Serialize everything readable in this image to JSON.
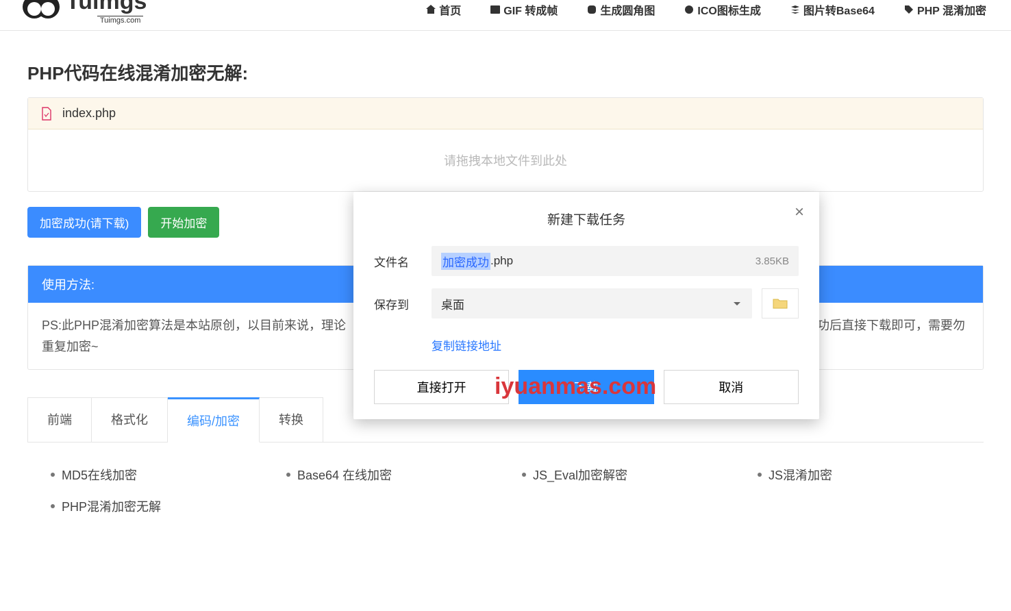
{
  "logo": {
    "text": "Tuimgs",
    "sub": "Tuimgs.com"
  },
  "nav": {
    "home": "首页",
    "gif": "GIF 转成帧",
    "circle": "生成圆角图",
    "ico": "ICO图标生成",
    "base64": "图片转Base64",
    "php": "PHP 混淆加密"
  },
  "page_title": "PHP代码在线混淆加密无解:",
  "upload": {
    "filename": "index.php",
    "drop_hint": "请拖拽本地文件到此处"
  },
  "buttons": {
    "download": "加密成功(请下载)",
    "start": "开始加密"
  },
  "usage": {
    "head": "使用方法:",
    "body_left": "PS:此PHP混淆加密算法是本站原创，以目前来说，理论",
    "body_right": "成功后直接下载即可，需要勿重复加密~"
  },
  "tabs": {
    "t1": "前端",
    "t2": "格式化",
    "t3": "编码/加密",
    "t4": "转换"
  },
  "tools": {
    "a": "MD5在线加密",
    "b": "Base64 在线加密",
    "c": "JS_Eval加密解密",
    "d": "JS混淆加密",
    "e": "PHP混淆加密无解"
  },
  "modal": {
    "title": "新建下载任务",
    "label_name": "文件名",
    "sel": "加密成功",
    "ext": ".php",
    "size": "3.85KB",
    "label_save": "保存到",
    "save_val": "桌面",
    "copy": "复制链接地址",
    "open": "直接打开",
    "download": "下载",
    "cancel": "取消"
  },
  "watermark": "iyuanmas.com"
}
